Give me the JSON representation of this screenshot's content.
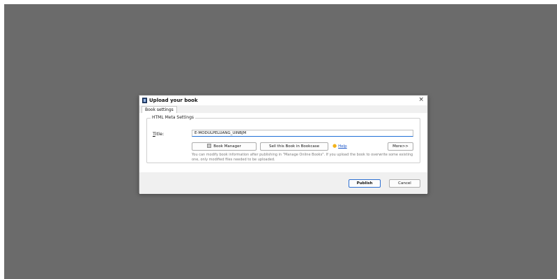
{
  "dialog": {
    "title": "Upload your book",
    "close_icon": "×",
    "tabs": [
      {
        "label": "Book settings"
      }
    ],
    "group": {
      "legend": "HTML Meta Settings",
      "title_label_hotkey": "T",
      "title_label_rest": "itle:",
      "title_value": "E-MODULPELUANG_UINBJM"
    },
    "buttons": {
      "book_manager": "Book Manager",
      "sell": "Sell this Book in Bookcase",
      "help": "Help",
      "more": "More>>",
      "publish": "Publish",
      "cancel": "Cancel"
    },
    "info_text": "You can modify book information after publishing in \"Manage Online Books\". If you upload the book to overwrite some existing one, only modified files needed to be uploaded.",
    "icons": {
      "app": "app-icon",
      "help": "lightbulb-icon",
      "book_manager": "book-manager-icon"
    },
    "colors": {
      "backdrop": "#6b6b6b",
      "accent": "#1f6fd6",
      "link": "#1a56c8",
      "help_icon": "#f2b21a"
    }
  }
}
